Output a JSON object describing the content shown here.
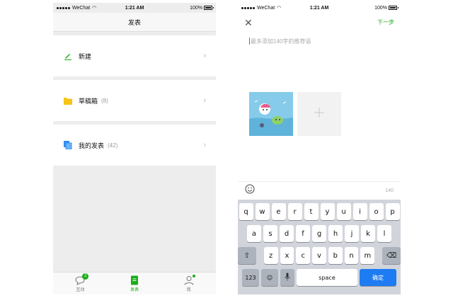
{
  "left": {
    "status": {
      "carrier": "WeChat",
      "time": "1:21 AM",
      "battery": "100%"
    },
    "title": "发表",
    "items": [
      {
        "label": "新建",
        "count": "",
        "icon": "pencil-icon"
      },
      {
        "label": "草稿箱",
        "count": "(8)",
        "icon": "folder-icon"
      },
      {
        "label": "我的发表",
        "count": "(42)",
        "icon": "documents-icon"
      }
    ],
    "tabbar": [
      {
        "label": "互动",
        "icon": "chat-bubble-icon",
        "badge": "2"
      },
      {
        "label": "发表",
        "icon": "document-icon",
        "active": true
      },
      {
        "label": "我",
        "icon": "person-icon",
        "dot": true
      }
    ]
  },
  "right": {
    "status": {
      "carrier": "WeChat",
      "time": "1:21 AM",
      "battery": "100%"
    },
    "close_icon": "close-icon",
    "next_label": "下一步",
    "placeholder": "最多添加140字的推荐语",
    "char_count": "140",
    "keyboard": {
      "row1": [
        "q",
        "w",
        "e",
        "r",
        "t",
        "y",
        "u",
        "i",
        "o",
        "p"
      ],
      "row2": [
        "a",
        "s",
        "d",
        "f",
        "g",
        "h",
        "j",
        "k",
        "l"
      ],
      "row3": [
        "z",
        "x",
        "c",
        "v",
        "b",
        "n",
        "m"
      ],
      "num_label": "123",
      "space_label": "space",
      "confirm_label": "确定"
    }
  },
  "colors": {
    "accent": "#1aad19",
    "folder": "#f5c518",
    "doc_blue": "#2f8ff3",
    "key_blue": "#1e7cf2"
  }
}
